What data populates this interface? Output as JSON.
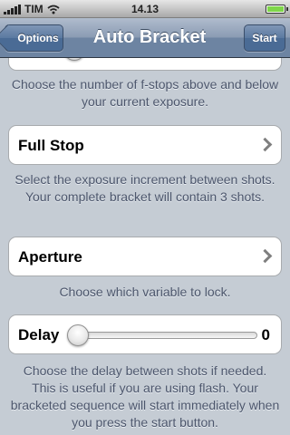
{
  "status": {
    "carrier": "TIM",
    "time": "14.13",
    "battery_level": 1.0
  },
  "nav": {
    "back_label": "Options",
    "title": "Auto Bracket",
    "start_label": "Start"
  },
  "content": {
    "fstops_desc_1": "Choose the number of f-stops above and below",
    "fstops_desc_2": "your current exposure.",
    "increment": {
      "label": "Full Stop",
      "desc_1": "Select the exposure increment between shots.",
      "desc_2": "Your complete bracket will contain 3 shots."
    },
    "lock": {
      "label": "Aperture",
      "desc": "Choose which variable to lock."
    },
    "delay": {
      "label": "Delay",
      "value": "0",
      "slider_fraction": 0.0,
      "desc_1": "Choose the delay between shots if needed.",
      "desc_2": "This is useful if you are using flash. Your",
      "desc_3": "bracketed sequence will start immediately when",
      "desc_4": "you press the start button."
    }
  },
  "icons": {
    "signal": "signal-bars-icon",
    "wifi": "wifi-icon",
    "battery": "battery-icon",
    "back": "back-arrow-icon",
    "chevron": "chevron-right-icon"
  },
  "colors": {
    "nav_bar": "#6d84a2",
    "background": "#c5ccd4",
    "description_text": "#4c566c"
  }
}
